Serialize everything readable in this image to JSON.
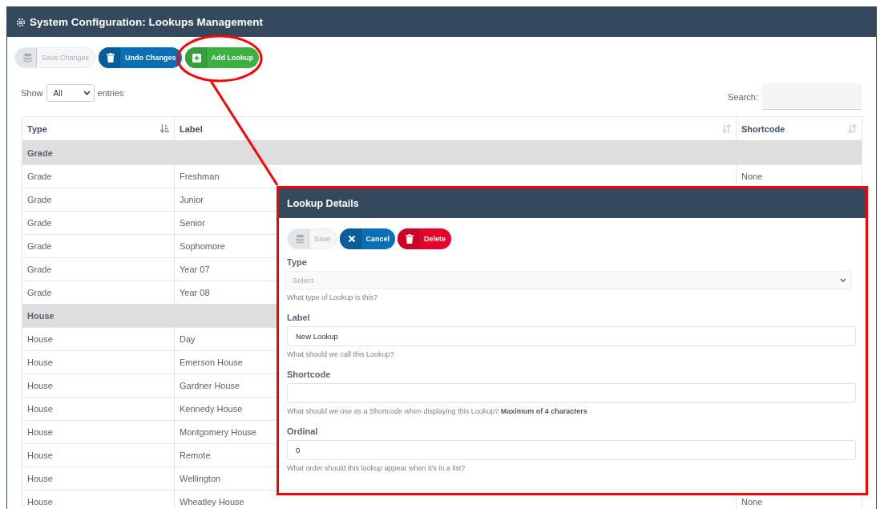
{
  "window": {
    "title": "System Configuration: Lookups Management"
  },
  "toolbar": [
    {
      "kind": "save",
      "label": "Save Changes",
      "disabled": true
    },
    {
      "kind": "undo",
      "label": "Undo Changes",
      "disabled": false
    },
    {
      "kind": "add",
      "label": "Add Lookup",
      "disabled": false
    }
  ],
  "length_menu": {
    "prefix": "Show",
    "value": "All",
    "suffix": "entries"
  },
  "search": {
    "label": "Search:"
  },
  "table": {
    "columns": [
      {
        "label": "Type",
        "sorted": true
      },
      {
        "label": "Label",
        "sorted": false
      },
      {
        "label": "Shortcode",
        "sorted": false
      }
    ],
    "groups": [
      {
        "label": "Grade",
        "rows": [
          {
            "type": "Grade",
            "label": "Freshman",
            "shortcode": "None"
          },
          {
            "type": "Grade",
            "label": "Junior"
          },
          {
            "type": "Grade",
            "label": "Senior"
          },
          {
            "type": "Grade",
            "label": "Sophomore"
          },
          {
            "type": "Grade",
            "label": "Year 07"
          },
          {
            "type": "Grade",
            "label": "Year 08"
          }
        ]
      },
      {
        "label": "House",
        "rows": [
          {
            "type": "House",
            "label": "Day"
          },
          {
            "type": "House",
            "label": "Emerson House"
          },
          {
            "type": "House",
            "label": "Gardner House"
          },
          {
            "type": "House",
            "label": "Kennedy House"
          },
          {
            "type": "House",
            "label": "Montgomery House"
          },
          {
            "type": "House",
            "label": "Remote"
          },
          {
            "type": "House",
            "label": "Wellington"
          },
          {
            "type": "House",
            "label": "Wheatley House",
            "shortcode": "None"
          }
        ]
      }
    ]
  },
  "dialog": {
    "title": "Lookup Details",
    "buttons": [
      {
        "kind": "save",
        "label": "Save",
        "disabled": true
      },
      {
        "kind": "cancel",
        "label": "Cancel",
        "disabled": false
      },
      {
        "kind": "delete",
        "label": "Delete",
        "disabled": false
      }
    ],
    "fields": [
      {
        "kind": "select",
        "label": "Type",
        "placeholder": "Select",
        "help": "What type of Lookup is this?"
      },
      {
        "kind": "text",
        "label": "Label",
        "value": "New Lookup",
        "help": "What should we call this Lookup?"
      },
      {
        "kind": "text",
        "label": "Shortcode",
        "help": "What should we use as a Shortcode when displaying this Lookup? **Maximum of 4 characters**"
      },
      {
        "kind": "text",
        "label": "Ordinal",
        "value": "0",
        "help": "What order should this lookup appear when it's in a list?"
      }
    ]
  }
}
